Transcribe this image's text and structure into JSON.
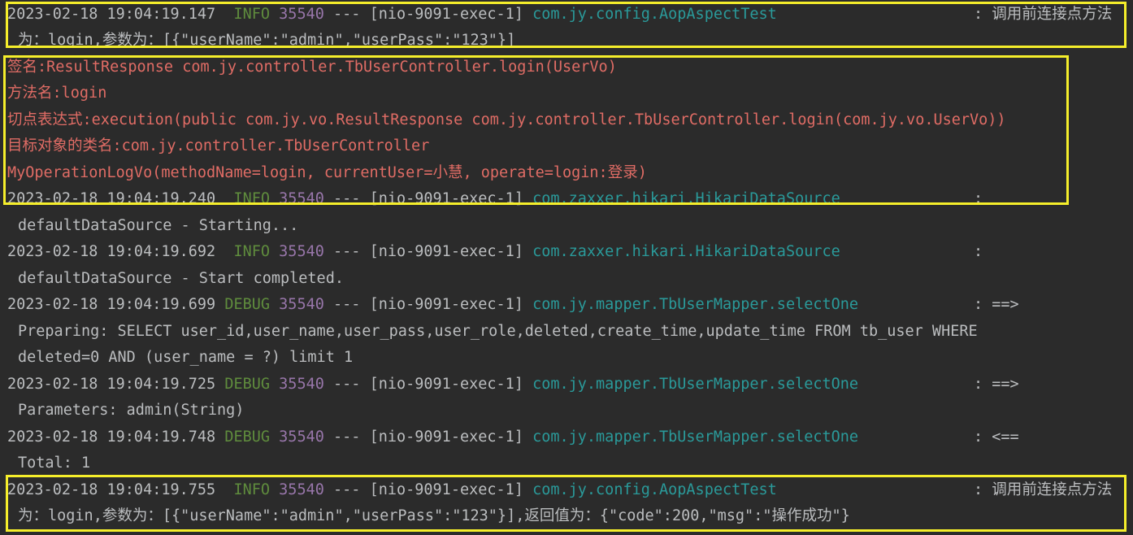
{
  "entries": [
    {
      "ts": "2023-02-18 19:04:19.147",
      "level": "INFO",
      "pid": "35540",
      "sep": "---",
      "thread": "[nio-9091-exec-1]",
      "logger": "com.jy.config.AopAspectTest",
      "colon": ":",
      "msg_head": "调用前连接点方法",
      "cont": "为：login,参数为：[{\"userName\":\"admin\",\"userPass\":\"123\"}]"
    },
    {
      "ts": "2023-02-18 19:04:19.240",
      "level": "INFO",
      "pid": "35540",
      "sep": "---",
      "thread": "[nio-9091-exec-1]",
      "logger": "com.zaxxer.hikari.HikariDataSource",
      "colon": ":",
      "msg_head": "",
      "cont": "defaultDataSource - Starting..."
    },
    {
      "ts": "2023-02-18 19:04:19.692",
      "level": "INFO",
      "pid": "35540",
      "sep": "---",
      "thread": "[nio-9091-exec-1]",
      "logger": "com.zaxxer.hikari.HikariDataSource",
      "colon": ":",
      "msg_head": "",
      "cont": "defaultDataSource - Start completed."
    },
    {
      "ts": "2023-02-18 19:04:19.699",
      "level": "DEBUG",
      "pid": "35540",
      "sep": "---",
      "thread": "[nio-9091-exec-1]",
      "logger": "com.jy.mapper.TbUserMapper.selectOne",
      "colon": ":",
      "msg_head": "==>",
      "cont": "Preparing: SELECT user_id,user_name,user_pass,user_role,deleted,create_time,update_time FROM tb_user WHERE",
      "cont2": "deleted=0 AND (user_name = ?) limit 1"
    },
    {
      "ts": "2023-02-18 19:04:19.725",
      "level": "DEBUG",
      "pid": "35540",
      "sep": "---",
      "thread": "[nio-9091-exec-1]",
      "logger": "com.jy.mapper.TbUserMapper.selectOne",
      "colon": ":",
      "msg_head": "==>",
      "cont": "Parameters: admin(String)"
    },
    {
      "ts": "2023-02-18 19:04:19.748",
      "level": "DEBUG",
      "pid": "35540",
      "sep": "---",
      "thread": "[nio-9091-exec-1]",
      "logger": "com.jy.mapper.TbUserMapper.selectOne",
      "colon": ":",
      "msg_head": "<==",
      "cont": "Total: 1"
    },
    {
      "ts": "2023-02-18 19:04:19.755",
      "level": "INFO",
      "pid": "35540",
      "sep": "---",
      "thread": "[nio-9091-exec-1]",
      "logger": "com.jy.config.AopAspectTest",
      "colon": ":",
      "msg_head": "调用前连接点方法",
      "cont": "为：login,参数为：[{\"userName\":\"admin\",\"userPass\":\"123\"}],返回值为：{\"code\":200,\"msg\":\"操作成功\"}"
    }
  ],
  "stdout": {
    "signature": "签名:ResultResponse com.jy.controller.TbUserController.login(UserVo)",
    "method": "方法名:login",
    "pointcut": "切点表达式:execution(public com.jy.vo.ResultResponse com.jy.controller.TbUserController.login(com.jy.vo.UserVo))",
    "target": "目标对象的类名:com.jy.controller.TbUserController",
    "oplog": "MyOperationLogVo(methodName=login, currentUser=小慧, operate=login:登录)"
  },
  "colors": {
    "highlight": "#f5ee2b",
    "stdout": "#e06c65",
    "logger": "#2a9a9a",
    "pid": "#9876aa",
    "level": "#5f8c3d"
  }
}
